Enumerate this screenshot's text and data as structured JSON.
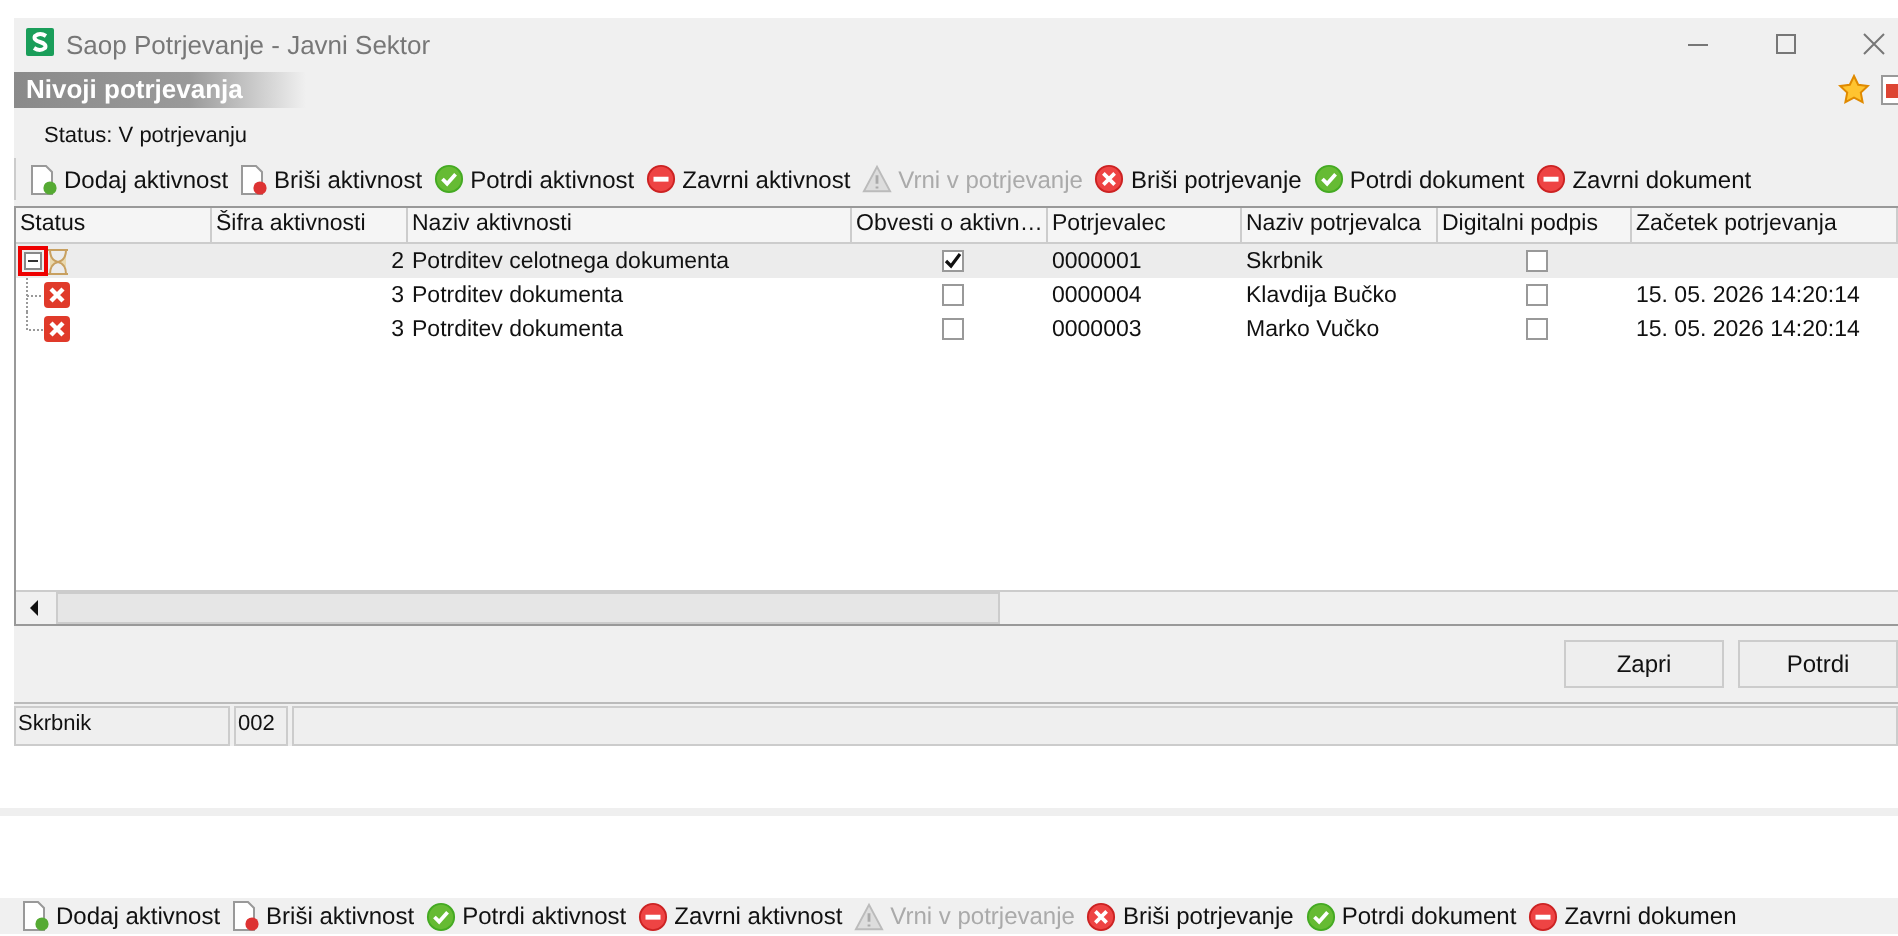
{
  "window": {
    "title": "Saop Potrjevanje - Javni Sektor"
  },
  "header": {
    "title": "Nivoji potrjevanja",
    "status": "Status: V potrjevanju"
  },
  "toolbar": [
    {
      "kind": "add",
      "label": "Dodaj aktivnost",
      "disabled": false
    },
    {
      "kind": "remove",
      "label": "Briši aktivnost",
      "disabled": false
    },
    {
      "kind": "confirm",
      "label": "Potrdi aktivnost",
      "disabled": false
    },
    {
      "kind": "stop",
      "label": "Zavrni aktivnost",
      "disabled": false
    },
    {
      "kind": "warning",
      "label": "Vrni v potrjevanje",
      "disabled": true
    },
    {
      "kind": "delete",
      "label": "Briši potrjevanje",
      "disabled": false
    },
    {
      "kind": "confirm",
      "label": "Potrdi dokument",
      "disabled": false
    },
    {
      "kind": "stop",
      "label": "Zavrni dokument",
      "disabled": false
    }
  ],
  "table": {
    "columns": [
      "Status",
      "Šifra aktivnosti",
      "Naziv aktivnosti",
      "Obvesti o aktivn…",
      "Potrjevalec",
      "Naziv potrjevalca",
      "Digitalni podpis",
      "Začetek potrjevanja"
    ],
    "rows": [
      {
        "kind": "pending",
        "expanded": true,
        "selected": true,
        "code": "2",
        "name": "Potrditev celotnega dokumenta",
        "notify": true,
        "approver": "0000001",
        "approver_name": "Skrbnik",
        "digital_signature": false,
        "start": "",
        "children": [
          {
            "kind": "rejected",
            "selected": false,
            "code": "3",
            "name": "Potrditev dokumenta",
            "notify": false,
            "approver": "0000004",
            "approver_name": "Klavdija Bučko",
            "digital_signature": false,
            "start": "15. 05. 2026 14:20:14"
          },
          {
            "kind": "rejected",
            "selected": false,
            "code": "3",
            "name": "Potrditev dokumenta",
            "notify": false,
            "approver": "0000003",
            "approver_name": "Marko Vučko",
            "digital_signature": false,
            "start": "15. 05. 2026 14:20:14"
          }
        ]
      }
    ]
  },
  "buttons": [
    "Zapri",
    "Potrdi"
  ],
  "status_bar": [
    "Skrbnik",
    "002"
  ],
  "bottom_toolbar": [
    {
      "kind": "add",
      "label": "Dodaj aktivnost",
      "disabled": false
    },
    {
      "kind": "remove",
      "label": "Briši aktivnost",
      "disabled": false
    },
    {
      "kind": "confirm",
      "label": "Potrdi aktivnost",
      "disabled": false
    },
    {
      "kind": "stop",
      "label": "Zavrni aktivnost",
      "disabled": false
    },
    {
      "kind": "warning",
      "label": "Vrni v potrjevanje",
      "disabled": true
    },
    {
      "kind": "delete",
      "label": "Briši potrjevanje",
      "disabled": false
    },
    {
      "kind": "confirm",
      "label": "Potrdi dokument",
      "disabled": false
    },
    {
      "kind": "stop",
      "label": "Zavrni dokumen",
      "disabled": false
    }
  ]
}
